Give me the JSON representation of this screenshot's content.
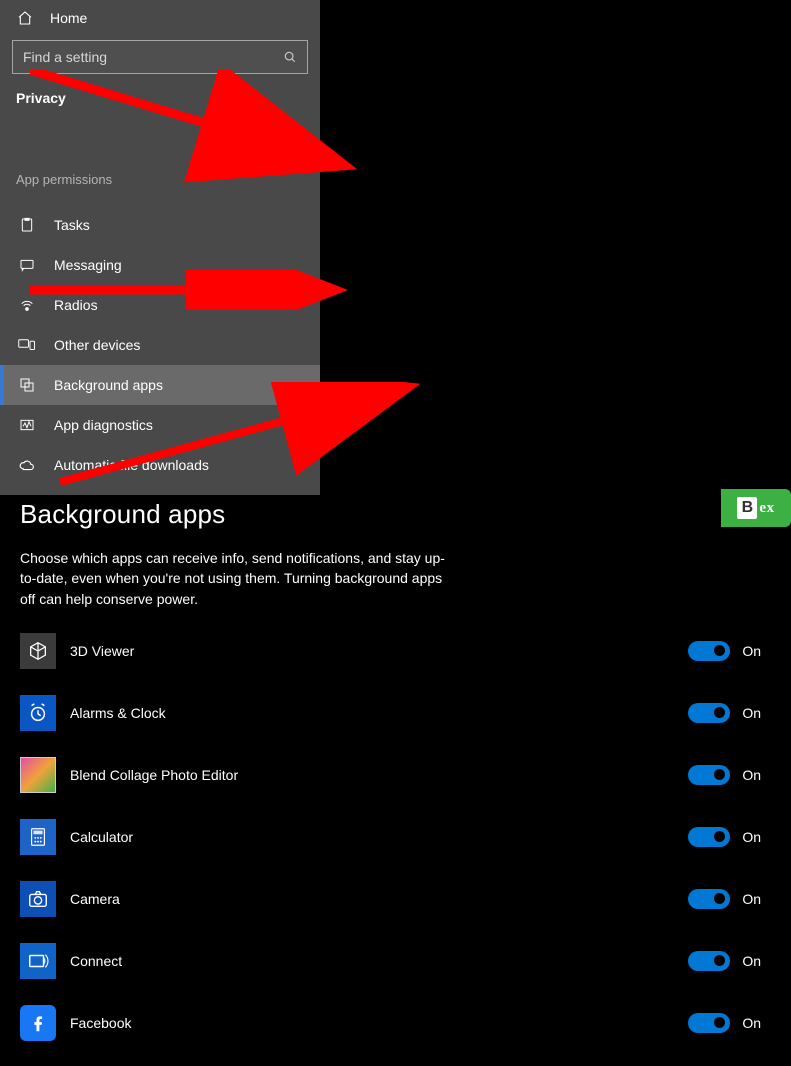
{
  "sidebar": {
    "home_label": "Home",
    "search_placeholder": "Find a setting",
    "section": "Privacy",
    "subheading": "App permissions",
    "items": [
      {
        "label": "Tasks",
        "icon": "tasks"
      },
      {
        "label": "Messaging",
        "icon": "messaging"
      },
      {
        "label": "Radios",
        "icon": "radios"
      },
      {
        "label": "Other devices",
        "icon": "other-devices"
      },
      {
        "label": "Background apps",
        "icon": "background-apps",
        "selected": true
      },
      {
        "label": "App diagnostics",
        "icon": "diagnostics"
      },
      {
        "label": "Automatic file downloads",
        "icon": "cloud"
      }
    ]
  },
  "main": {
    "title": "Background apps",
    "description": "Choose which apps can receive info, send notifications, and stay up-to-date, even when you're not using them. Turning background apps off can help conserve power.",
    "toggle_on_label": "On",
    "apps": [
      {
        "name": "3D Viewer",
        "iconClass": "ic-3d",
        "on": true
      },
      {
        "name": "Alarms & Clock",
        "iconClass": "ic-alarm",
        "on": true
      },
      {
        "name": "Blend Collage Photo Editor",
        "iconClass": "ic-blend",
        "on": true
      },
      {
        "name": "Calculator",
        "iconClass": "ic-calc",
        "on": true
      },
      {
        "name": "Camera",
        "iconClass": "ic-camera",
        "on": true
      },
      {
        "name": "Connect",
        "iconClass": "ic-connect",
        "on": true
      },
      {
        "name": "Facebook",
        "iconClass": "ic-fb",
        "on": true
      }
    ]
  },
  "watermark": {
    "text": "Bex"
  }
}
